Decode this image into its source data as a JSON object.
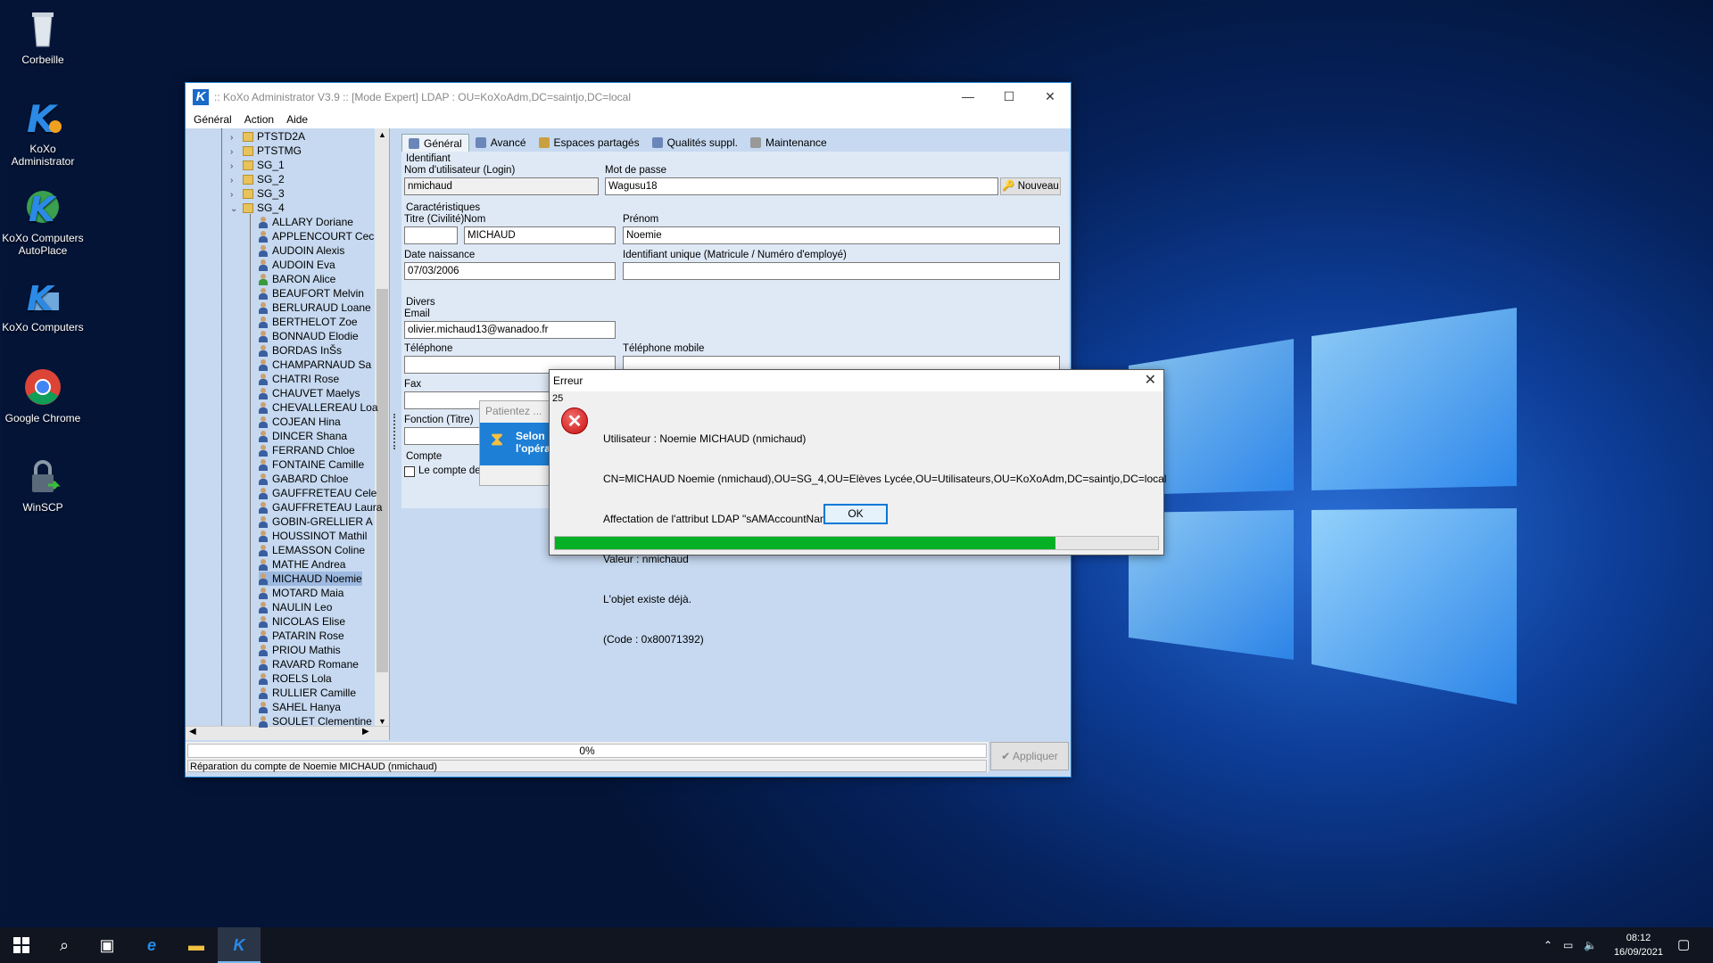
{
  "desktop": {
    "icons": [
      {
        "label": "Corbeille",
        "icon": "recycle-bin-icon"
      },
      {
        "label": "KoXo Administrator",
        "icon": "koxo-admin-icon"
      },
      {
        "label": "KoXo Computers AutoPlace",
        "icon": "koxo-autoplace-icon"
      },
      {
        "label": "KoXo Computers",
        "icon": "koxo-computers-icon"
      },
      {
        "label": "Google Chrome",
        "icon": "chrome-icon"
      },
      {
        "label": "WinSCP",
        "icon": "winscp-icon"
      }
    ]
  },
  "window": {
    "title": ":: KoXo Administrator V3.9 :: [Mode Expert] LDAP : OU=KoXoAdm,DC=saintjo,DC=local",
    "controls": {
      "minimize": "—",
      "maximize": "☐",
      "close": "✕"
    },
    "menu": [
      "Général",
      "Action",
      "Aide"
    ]
  },
  "tree": {
    "folders": [
      {
        "label": "PTSTD2A",
        "expanded": false
      },
      {
        "label": "PTSTMG",
        "expanded": false
      },
      {
        "label": "SG_1",
        "expanded": false
      },
      {
        "label": "SG_2",
        "expanded": false
      },
      {
        "label": "SG_3",
        "expanded": false
      },
      {
        "label": "SG_4",
        "expanded": true
      }
    ],
    "users": [
      "ALLARY Doriane",
      "APPLENCOURT Cec",
      "AUDOIN Alexis",
      "AUDOIN Eva",
      "BARON Alice",
      "BEAUFORT Melvin",
      "BERLURAUD Loane",
      "BERTHELOT Zoe",
      "BONNAUD Elodie",
      "BORDAS InŠs",
      "CHAMPARNAUD Sa",
      "CHATRI Rose",
      "CHAUVET Maelys",
      "CHEVALLEREAU Loa",
      "COJEAN Hina",
      "DINCER Shana",
      "FERRAND Chloe",
      "FONTAINE Camille",
      "GABARD Chloe",
      "GAUFFRETEAU Cele",
      "GAUFFRETEAU Laura",
      "GOBIN-GRELLIER A",
      "HOUSSINOT Mathil",
      "LEMASSON Coline",
      "MATHE Andrea",
      "MICHAUD Noemie",
      "MOTARD Maia",
      "NAULIN Leo",
      "NICOLAS Elise",
      "PATARIN Rose",
      "PRIOU Mathis",
      "RAVARD Romane",
      "ROELS Lola",
      "RULLIER Camille",
      "SAHEL Hanya",
      "SOULET Clementine"
    ],
    "selected_user": "MICHAUD Noemie",
    "green_user": "BARON Alice"
  },
  "tabs": [
    "Général",
    "Avancé",
    "Espaces partagés",
    "Qualités suppl.",
    "Maintenance"
  ],
  "form": {
    "section_identifiant": "Identifiant",
    "login_label": "Nom d'utilisateur (Login)",
    "login_value": "nmichaud",
    "password_label": "Mot de passe",
    "password_value": "Wagusu18",
    "nouveau_label": "Nouveau",
    "section_caract": "Caractéristiques",
    "titre_label": "Titre (Civilité)",
    "titre_value": "",
    "nom_label": "Nom",
    "nom_value": "MICHAUD",
    "prenom_label": "Prénom",
    "prenom_value": "Noemie",
    "naissance_label": "Date naissance",
    "naissance_value": "07/03/2006",
    "uid_label": "Identifiant unique (Matricule / Numéro d'employé)",
    "uid_value": "",
    "section_divers": "Divers",
    "email_label": "Email",
    "email_value": "olivier.michaud13@wanadoo.fr",
    "tel_label": "Téléphone",
    "mobile_label": "Téléphone mobile",
    "fax_label": "Fax",
    "fonction_label": "Fonction (Titre)",
    "section_compte": "Compte",
    "compte_checkbox": "Le compte de l'utilisateur est dé"
  },
  "wait_popup": {
    "text": "Patientez ...",
    "button_line1": "Selon",
    "button_line2": "l'opéra"
  },
  "status": {
    "progress_text": "0%",
    "message": "Réparation du compte de Noemie MICHAUD (nmichaud)",
    "apply_label": "Appliquer"
  },
  "error_dialog": {
    "title": "Erreur",
    "number": "25",
    "lines": [
      "Utilisateur : Noemie MICHAUD (nmichaud)",
      "CN=MICHAUD Noemie (nmichaud),OU=SG_4,OU=Elèves Lycée,OU=Utilisateurs,OU=KoXoAdm,DC=saintjo,DC=local",
      "Affectation de l'attribut LDAP \"sAMAccountName\"",
      "Valeur : nmichaud",
      "L'objet existe déjà.",
      "(Code : 0x80071392)"
    ],
    "ok_label": "OK",
    "progress_fraction": 0.83
  },
  "taskbar": {
    "time": "08:12",
    "date": "16/09/2021"
  },
  "colors": {
    "progress_green": "#06b025",
    "accent": "#0078d7",
    "tree_bg": "#c6d9f0"
  }
}
